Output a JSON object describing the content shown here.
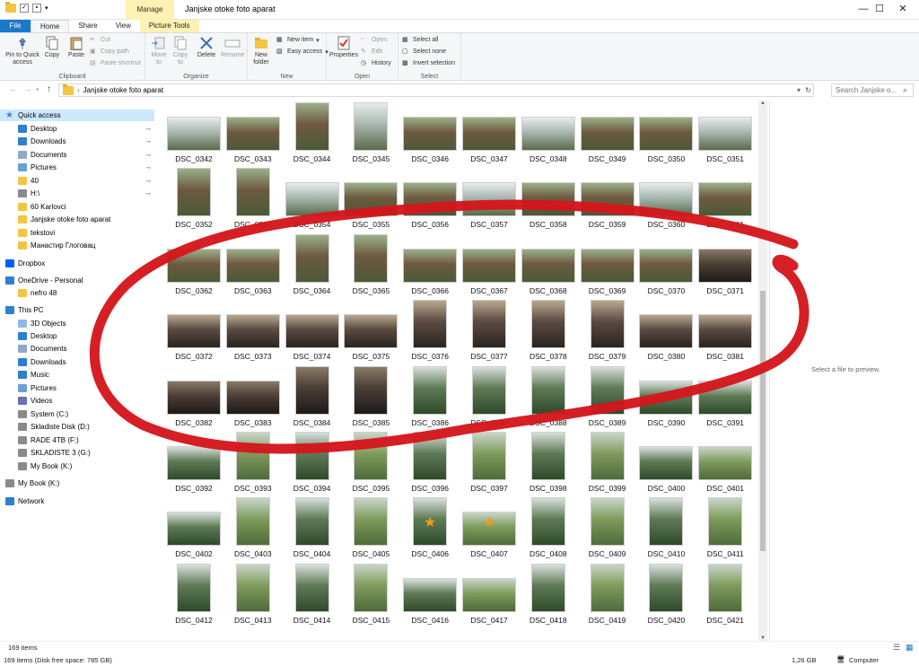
{
  "window": {
    "title": "Janjske otoke foto aparat",
    "manage_tab": "Manage",
    "minimize": "—",
    "maximize": "☐",
    "close": "✕"
  },
  "ribbon_tabs": [
    "File",
    "Home",
    "Share",
    "View",
    "Picture Tools"
  ],
  "ribbon": {
    "clipboard": {
      "label": "Clipboard",
      "pin": "Pin to Quick access",
      "copy": "Copy",
      "paste": "Paste",
      "cut": "Cut",
      "copy_path": "Copy path",
      "paste_shortcut": "Paste shortcut"
    },
    "organize": {
      "label": "Organize",
      "move_to": "Move to",
      "copy_to": "Copy to",
      "delete": "Delete",
      "rename": "Rename"
    },
    "new": {
      "label": "New",
      "new_folder": "New folder",
      "new_item": "New item",
      "easy_access": "Easy access"
    },
    "open": {
      "label": "Open",
      "properties": "Properties",
      "open": "Open",
      "edit": "Edit",
      "history": "History"
    },
    "select": {
      "label": "Select",
      "select_all": "Select all",
      "select_none": "Select none",
      "invert": "Invert selection"
    }
  },
  "address": {
    "path": "Janjske otoke foto aparat",
    "search_placeholder": "Search Janjske o..."
  },
  "sidebar": {
    "items": [
      {
        "label": "Quick access",
        "icon": "star-icon",
        "pinned": false
      },
      {
        "label": "Desktop",
        "icon": "desktop-icon",
        "pinned": true
      },
      {
        "label": "Downloads",
        "icon": "download-icon",
        "pinned": true
      },
      {
        "label": "Documents",
        "icon": "documents-icon",
        "pinned": true
      },
      {
        "label": "Pictures",
        "icon": "pictures-icon",
        "pinned": true
      },
      {
        "label": "40",
        "icon": "folder-icon",
        "pinned": true
      },
      {
        "label": "H:\\",
        "icon": "drive-icon",
        "pinned": true
      },
      {
        "label": "60 Karlovci",
        "icon": "folder-icon",
        "pinned": false
      },
      {
        "label": "Janjske otoke foto aparat",
        "icon": "folder-icon",
        "pinned": false
      },
      {
        "label": "tekstovi",
        "icon": "folder-icon",
        "pinned": false
      },
      {
        "label": "Манастир Глоговац",
        "icon": "folder-icon",
        "pinned": false
      },
      {
        "label": "Dropbox",
        "icon": "dropbox-icon",
        "pinned": false
      },
      {
        "label": "OneDrive - Personal",
        "icon": "cloud-icon",
        "pinned": false
      },
      {
        "label": "nefro 48",
        "icon": "folder-icon",
        "pinned": false
      },
      {
        "label": "This PC",
        "icon": "pc-icon",
        "pinned": false
      },
      {
        "label": "3D Objects",
        "icon": "cube-icon",
        "pinned": false
      },
      {
        "label": "Desktop",
        "icon": "desktop-icon",
        "pinned": false
      },
      {
        "label": "Documents",
        "icon": "documents-icon",
        "pinned": false
      },
      {
        "label": "Downloads",
        "icon": "download-icon",
        "pinned": false
      },
      {
        "label": "Music",
        "icon": "music-icon",
        "pinned": false
      },
      {
        "label": "Pictures",
        "icon": "pictures-icon",
        "pinned": false
      },
      {
        "label": "Videos",
        "icon": "video-icon",
        "pinned": false
      },
      {
        "label": "System (C:)",
        "icon": "drive-icon",
        "pinned": false
      },
      {
        "label": "Skladiste Disk (D:)",
        "icon": "drive-icon",
        "pinned": false
      },
      {
        "label": "RADE 4TB (F:)",
        "icon": "drive-icon",
        "pinned": false
      },
      {
        "label": "SKLADISTE 3 (G:)",
        "icon": "drive-icon",
        "pinned": false
      },
      {
        "label": "My Book (K:)",
        "icon": "drive-icon",
        "pinned": false
      },
      {
        "label": "My Book (K:)",
        "icon": "drive-icon",
        "pinned": false
      },
      {
        "label": "Network",
        "icon": "network-icon",
        "pinned": false
      }
    ]
  },
  "files": [
    "DSC_0342",
    "DSC_0343",
    "DSC_0344",
    "DSC_0345",
    "DSC_0346",
    "DSC_0347",
    "DSC_0348",
    "DSC_0349",
    "DSC_0350",
    "DSC_0351",
    "DSC_0352",
    "DSC_0353",
    "DSC_0354",
    "DSC_0355",
    "DSC_0356",
    "DSC_0357",
    "DSC_0358",
    "DSC_0359",
    "DSC_0360",
    "DSC_0361",
    "DSC_0362",
    "DSC_0363",
    "DSC_0364",
    "DSC_0365",
    "DSC_0366",
    "DSC_0367",
    "DSC_0368",
    "DSC_0369",
    "DSC_0370",
    "DSC_0371",
    "DSC_0372",
    "DSC_0373",
    "DSC_0374",
    "DSC_0375",
    "DSC_0376",
    "DSC_0377",
    "DSC_0378",
    "DSC_0379",
    "DSC_0380",
    "DSC_0381",
    "DSC_0382",
    "DSC_0383",
    "DSC_0384",
    "DSC_0385",
    "DSC_0386",
    "DSC_0387",
    "DSC_0388",
    "DSC_0389",
    "DSC_0390",
    "DSC_0391",
    "DSC_0392",
    "DSC_0393",
    "DSC_0394",
    "DSC_0395",
    "DSC_0396",
    "DSC_0397",
    "DSC_0398",
    "DSC_0399",
    "DSC_0400",
    "DSC_0401",
    "DSC_0402",
    "DSC_0403",
    "DSC_0404",
    "DSC_0405",
    "DSC_0406",
    "DSC_0407",
    "DSC_0408",
    "DSC_0409",
    "DSC_0410",
    "DSC_0411",
    "DSC_0412",
    "DSC_0413",
    "DSC_0414",
    "DSC_0415",
    "DSC_0416",
    "DSC_0417",
    "DSC_0418",
    "DSC_0419",
    "DSC_0420",
    "DSC_0421"
  ],
  "starred_files": [
    "DSC_0406",
    "DSC_0407"
  ],
  "preview": {
    "text": "Select a file to preview."
  },
  "status": {
    "items_count": "169 items",
    "bottom_text": "169 items (Disk free space: 785 GB)",
    "size": "1,26 GB",
    "location": "Computer"
  },
  "colors": {
    "accent": "#1979ca",
    "annotation": "#d4161c",
    "manage": "#fdf1b3"
  }
}
